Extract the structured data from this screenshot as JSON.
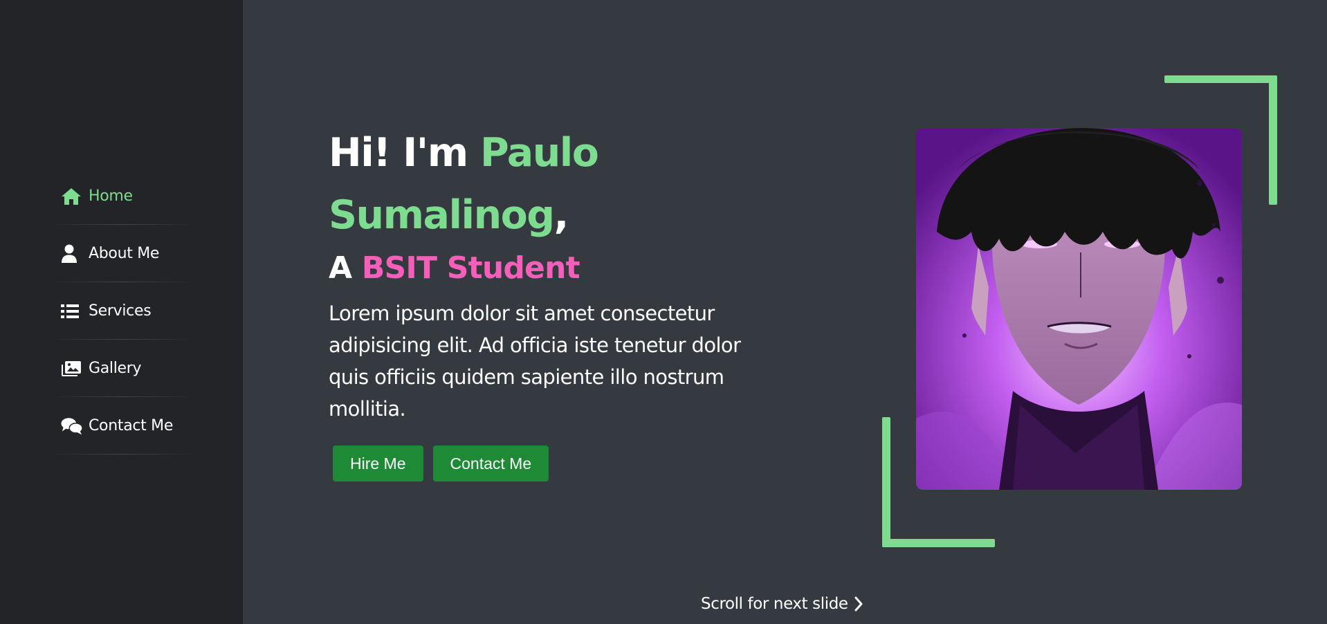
{
  "sidebar": {
    "items": [
      {
        "label": "Home",
        "icon": "home-icon",
        "active": true
      },
      {
        "label": "About Me",
        "icon": "user-icon",
        "active": false
      },
      {
        "label": "Services",
        "icon": "list-icon",
        "active": false
      },
      {
        "label": "Gallery",
        "icon": "images-icon",
        "active": false
      },
      {
        "label": "Contact Me",
        "icon": "comments-icon",
        "active": false
      }
    ]
  },
  "hero": {
    "greeting": "Hi! I'm ",
    "name": "Paulo Sumalinog",
    "comma": ",",
    "role_prefix": "A ",
    "role": "BSIT Student",
    "description": "Lorem ipsum dolor sit amet consectetur adipisicing elit. Ad officia iste tenetur dolor quis officiis quidem sapiente illo nostrum mollitia.",
    "hire_label": "Hire Me",
    "contact_label": "Contact Me"
  },
  "scroll_hint": "Scroll for next slide",
  "colors": {
    "accent_green": "#7ddc8f",
    "accent_pink": "#f55fba",
    "button_green": "#1f8a36",
    "background": "#353a41",
    "sidebar": "#222428"
  }
}
